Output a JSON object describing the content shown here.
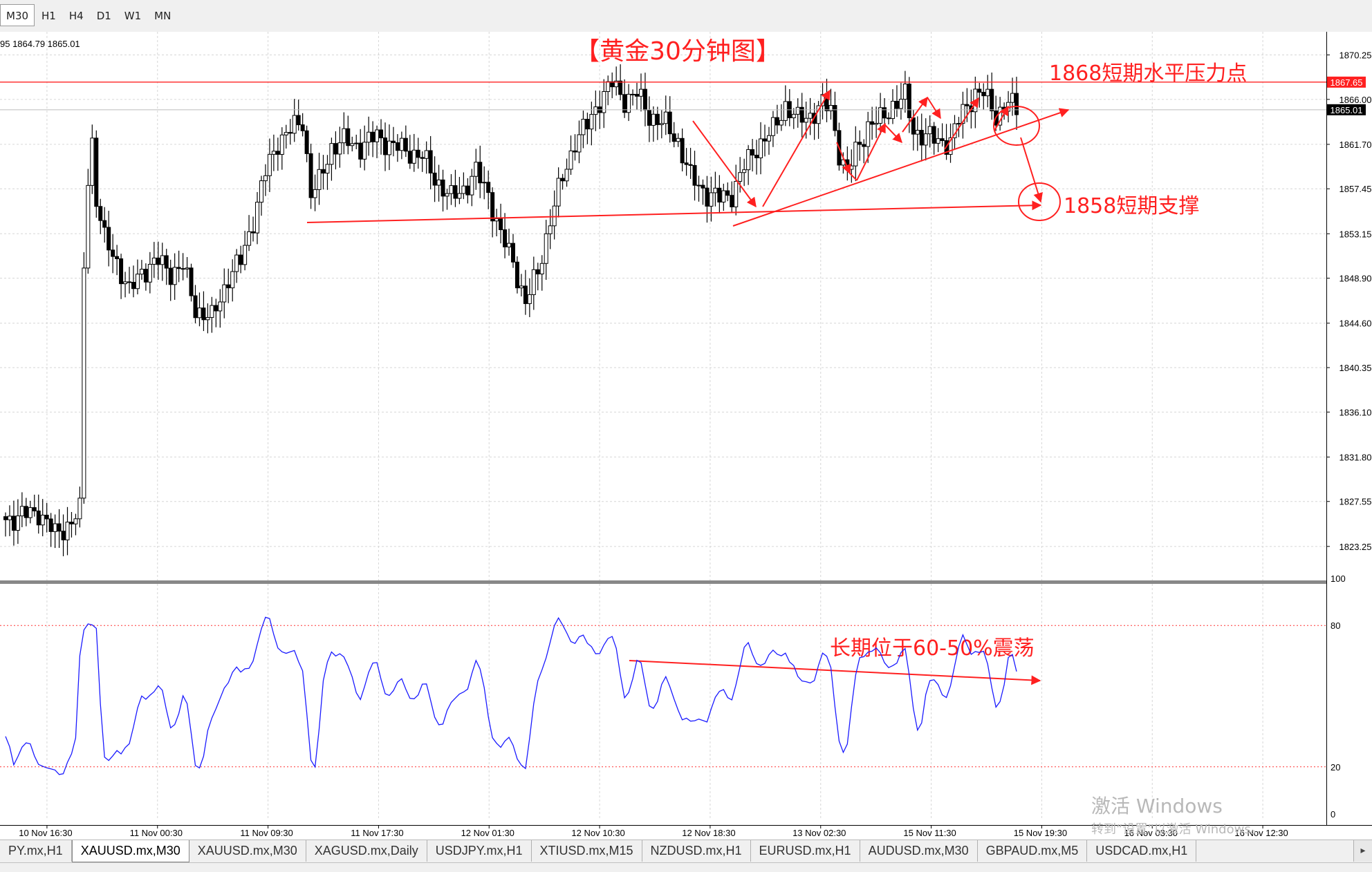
{
  "toolbar": {
    "timeframes": [
      {
        "label": "M30",
        "active": true
      },
      {
        "label": "H1",
        "active": false
      },
      {
        "label": "H4",
        "active": false
      },
      {
        "label": "D1",
        "active": false
      },
      {
        "label": "W1",
        "active": false
      },
      {
        "label": "MN",
        "active": false
      }
    ]
  },
  "chart_data": {
    "type": "candlestick",
    "title": "【黄金30分钟图】",
    "ohlc_readout": "95 1864.79 1865.01",
    "price_axis": {
      "min": 1820,
      "max": 1872.2,
      "ticks": [
        "1870.25",
        "1866.00",
        "1861.70",
        "1857.45",
        "1853.15",
        "1848.90",
        "1844.60",
        "1840.35",
        "1836.10",
        "1831.80",
        "1827.55",
        "1823.25"
      ],
      "current_price_label": "1865.01",
      "current_price": 1865.01,
      "level_label": "1867.65",
      "level_price": 1867.65
    },
    "time_labels": [
      "10 Nov 16:30",
      "11 Nov 00:30",
      "11 Nov 09:30",
      "11 Nov 17:30",
      "12 Nov 01:30",
      "12 Nov 10:30",
      "12 Nov 18:30",
      "13 Nov 02:30",
      "15 Nov 11:30",
      "15 Nov 19:30",
      "16 Nov 03:30",
      "16 Nov 12:30"
    ],
    "indicator": {
      "ticks": [
        "100",
        "80",
        "20",
        "0"
      ],
      "levels": [
        80,
        20
      ],
      "color": "#1a1aff"
    },
    "annotations": {
      "resistance": "1868短期水平压力点",
      "support": "1858短期支撑",
      "oscillator": "长期位于60-50%震荡"
    },
    "colors": {
      "annotation": "#ff2020",
      "candle_up": "#ffffff",
      "candle_down": "#000000",
      "indicator_line": "#1a1aff"
    }
  },
  "watermark": {
    "line1": "激活 Windows",
    "line2": "转到“设置”以激活 Windows。"
  },
  "tabs": [
    {
      "label": "PY.mx,H1",
      "active": false
    },
    {
      "label": "XAUUSD.mx,M30",
      "active": true
    },
    {
      "label": "XAUUSD.mx,M30",
      "active": false
    },
    {
      "label": "XAGUSD.mx,Daily",
      "active": false
    },
    {
      "label": "USDJPY.mx,H1",
      "active": false
    },
    {
      "label": "XTIUSD.mx,M15",
      "active": false
    },
    {
      "label": "NZDUSD.mx,H1",
      "active": false
    },
    {
      "label": "EURUSD.mx,H1",
      "active": false
    },
    {
      "label": "AUDUSD.mx,M30",
      "active": false
    },
    {
      "label": "GBPAUD.mx,M5",
      "active": false
    },
    {
      "label": "USDCAD.mx,H1",
      "active": false
    }
  ]
}
